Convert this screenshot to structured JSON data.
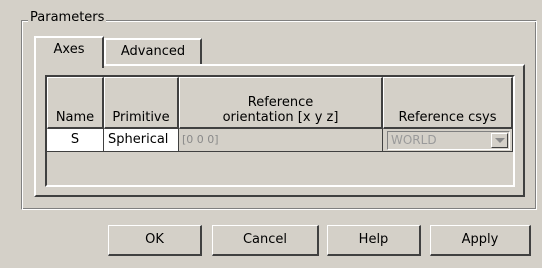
{
  "group": {
    "title": "Parameters"
  },
  "tabs": [
    {
      "label": "Axes",
      "active": true
    },
    {
      "label": "Advanced",
      "active": false
    }
  ],
  "table": {
    "headers": [
      "Name",
      "Primitive",
      "Reference\norientation [x y z]",
      "Reference csys"
    ],
    "rows": [
      {
        "name": "S",
        "primitive": "Spherical",
        "orientation": "[0 0 0]",
        "csys": "WORLD"
      }
    ]
  },
  "buttons": {
    "ok": "OK",
    "cancel": "Cancel",
    "help": "Help",
    "apply": "Apply"
  }
}
